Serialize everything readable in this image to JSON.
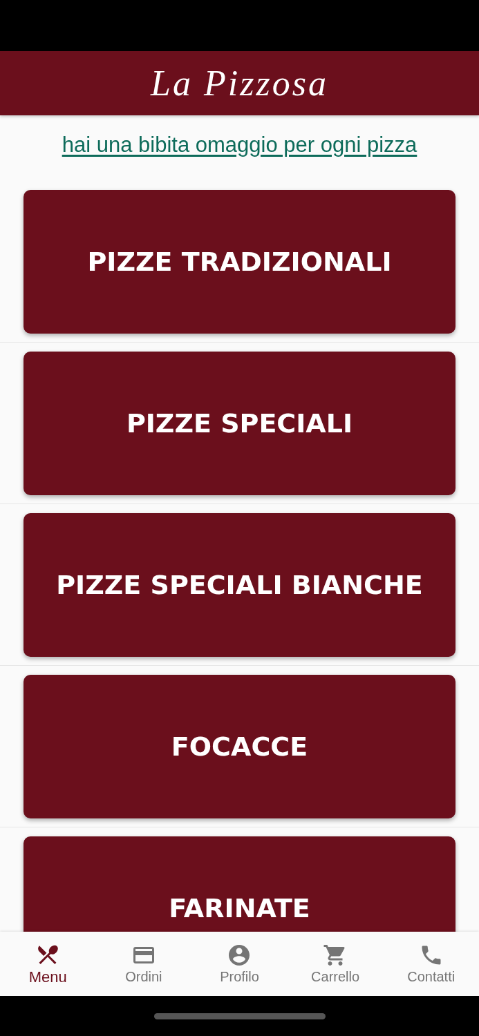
{
  "header": {
    "logo": "La Pizzosa"
  },
  "promo": {
    "link": "hai una bibita omaggio per ogni pizza"
  },
  "categories": [
    {
      "label": "PIZZE TRADIZIONALI"
    },
    {
      "label": "PIZZE SPECIALI"
    },
    {
      "label": "PIZZE SPECIALI BIANCHE"
    },
    {
      "label": "FOCACCE"
    },
    {
      "label": "FARINATE"
    }
  ],
  "bottom_nav": [
    {
      "label": "Menu",
      "kind": "cutlery",
      "selected": true
    },
    {
      "label": "Ordini",
      "kind": "card",
      "selected": false
    },
    {
      "label": "Profilo",
      "kind": "profile",
      "selected": false
    },
    {
      "label": "Carrello",
      "kind": "cart",
      "selected": false
    },
    {
      "label": "Contatti",
      "kind": "phone",
      "selected": false
    }
  ]
}
